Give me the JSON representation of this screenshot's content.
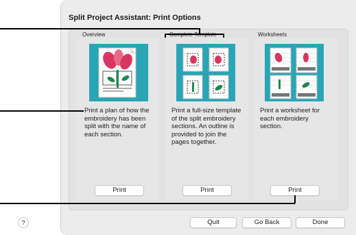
{
  "dialog": {
    "title": "Split Project Assistant: Print Options"
  },
  "columns": [
    {
      "label": "Overview",
      "description": "Print a plan of how the embroidery has been split with the name of each section.",
      "button": "Print",
      "image_icon": "overview-plan-icon"
    },
    {
      "label": "Complete Template",
      "description": "Print a full-size template of the split embroidery sections. An outline is provided to join the pages together.",
      "button": "Print",
      "image_icon": "template-pages-icon"
    },
    {
      "label": "Worksheets",
      "description": "Print a worksheet for each embroidery section.",
      "button": "Print",
      "image_icon": "worksheet-pages-icon"
    }
  ],
  "footer": {
    "help": "?",
    "quit": "Quit",
    "go_back": "Go Back",
    "done": "Done"
  },
  "colors": {
    "image_bg": "#2aa5b5",
    "petal": "#d9365f",
    "leaf": "#1e8a4e",
    "page": "#ffffff"
  }
}
